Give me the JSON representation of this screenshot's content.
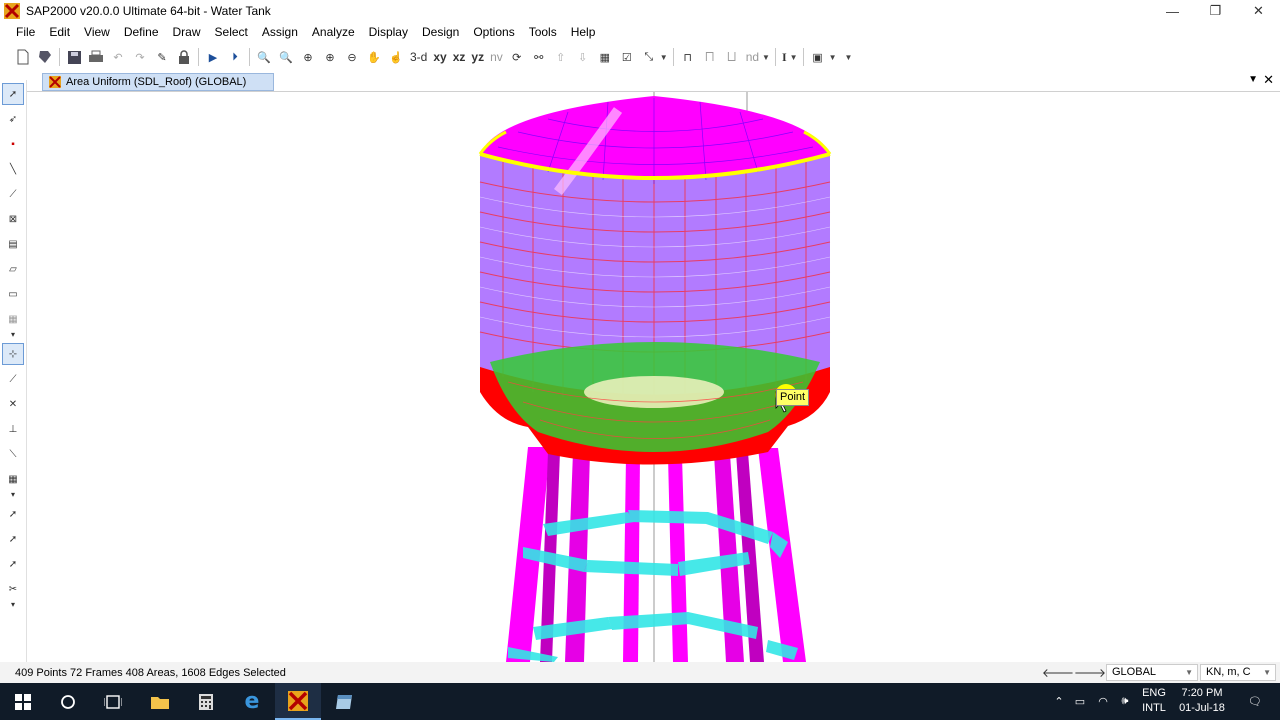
{
  "window": {
    "title": "SAP2000 v20.0.0 Ultimate 64-bit - Water Tank",
    "minimize": "—",
    "restore": "❐",
    "close": "✕"
  },
  "menu": [
    "File",
    "Edit",
    "View",
    "Define",
    "Draw",
    "Select",
    "Assign",
    "Analyze",
    "Display",
    "Design",
    "Options",
    "Tools",
    "Help"
  ],
  "toolbar": {
    "view_3d": "3-d",
    "view_xy": "xy",
    "view_xz": "xz",
    "view_yz": "yz",
    "view_nv": "nv",
    "nd_label": "nd",
    "text_tool": "I"
  },
  "tab": {
    "label": "Area Uniform (SDL_Roof) (GLOBAL)"
  },
  "viewport": {
    "tooltip": "Point",
    "colors": {
      "shell": "#ff00ff",
      "wall": "#b27bff",
      "rim_yellow": "#ffff00",
      "base_ring": "#ff0000",
      "cone": "#33cc33",
      "bracing": "#33e6e6"
    }
  },
  "status": {
    "selection": "409 Points  72 Frames  408 Areas, 1608 Edges Selected",
    "coord_system": "GLOBAL",
    "units": "KN, m, C"
  },
  "taskbar": {
    "lang_top": "ENG",
    "lang_bottom": "INTL",
    "time": "7:20 PM",
    "date": "01-Jul-18"
  }
}
